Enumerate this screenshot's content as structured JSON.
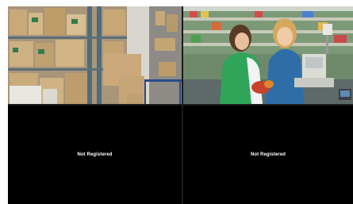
{
  "cameras": [
    {
      "scene": "warehouse-camera-feed"
    },
    {
      "scene": "retail-checkout-camera-feed"
    },
    {
      "status_text": "Not Registered"
    },
    {
      "status_text": "Not Registered"
    }
  ]
}
